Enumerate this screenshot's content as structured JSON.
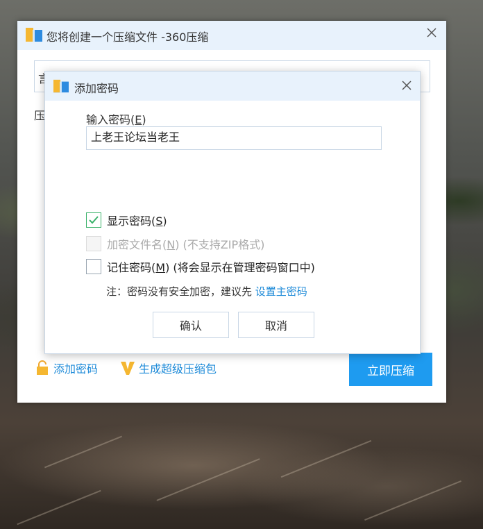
{
  "main_window": {
    "title": "您将创建一个压缩文件 -360压缩",
    "path_partial": "言",
    "label_partial": "压",
    "add_password": "添加密码",
    "super_pack": "生成超级压缩包",
    "compress_button": "立即压缩"
  },
  "dialog": {
    "title": "添加密码",
    "password_label": "输入密码(",
    "password_label_key": "E",
    "password_label_end": ")",
    "password_value": "上老王论坛当老王",
    "show_password": {
      "text": "显示密码(",
      "key": "S",
      "end": ")",
      "checked": true
    },
    "encrypt_filename": {
      "text": "加密文件名(",
      "key": "N",
      "end": ") (不支持ZIP格式)",
      "checked": false,
      "disabled": true
    },
    "remember_password": {
      "text": "记住密码(",
      "key": "M",
      "end": ") (将会显示在管理密码窗口中)",
      "checked": false
    },
    "note_text": "注：密码没有安全加密，建议先 ",
    "note_link": "设置主密码",
    "ok_button": "确认",
    "cancel_button": "取消"
  },
  "colors": {
    "accent": "#1e9bf0",
    "link": "#1d8ad8",
    "titlebar": "#e8f2fc",
    "check": "#3ab26a"
  },
  "icons": [
    "archive-icon",
    "close-icon",
    "lock-icon",
    "super-v-icon",
    "checkmark-icon"
  ]
}
